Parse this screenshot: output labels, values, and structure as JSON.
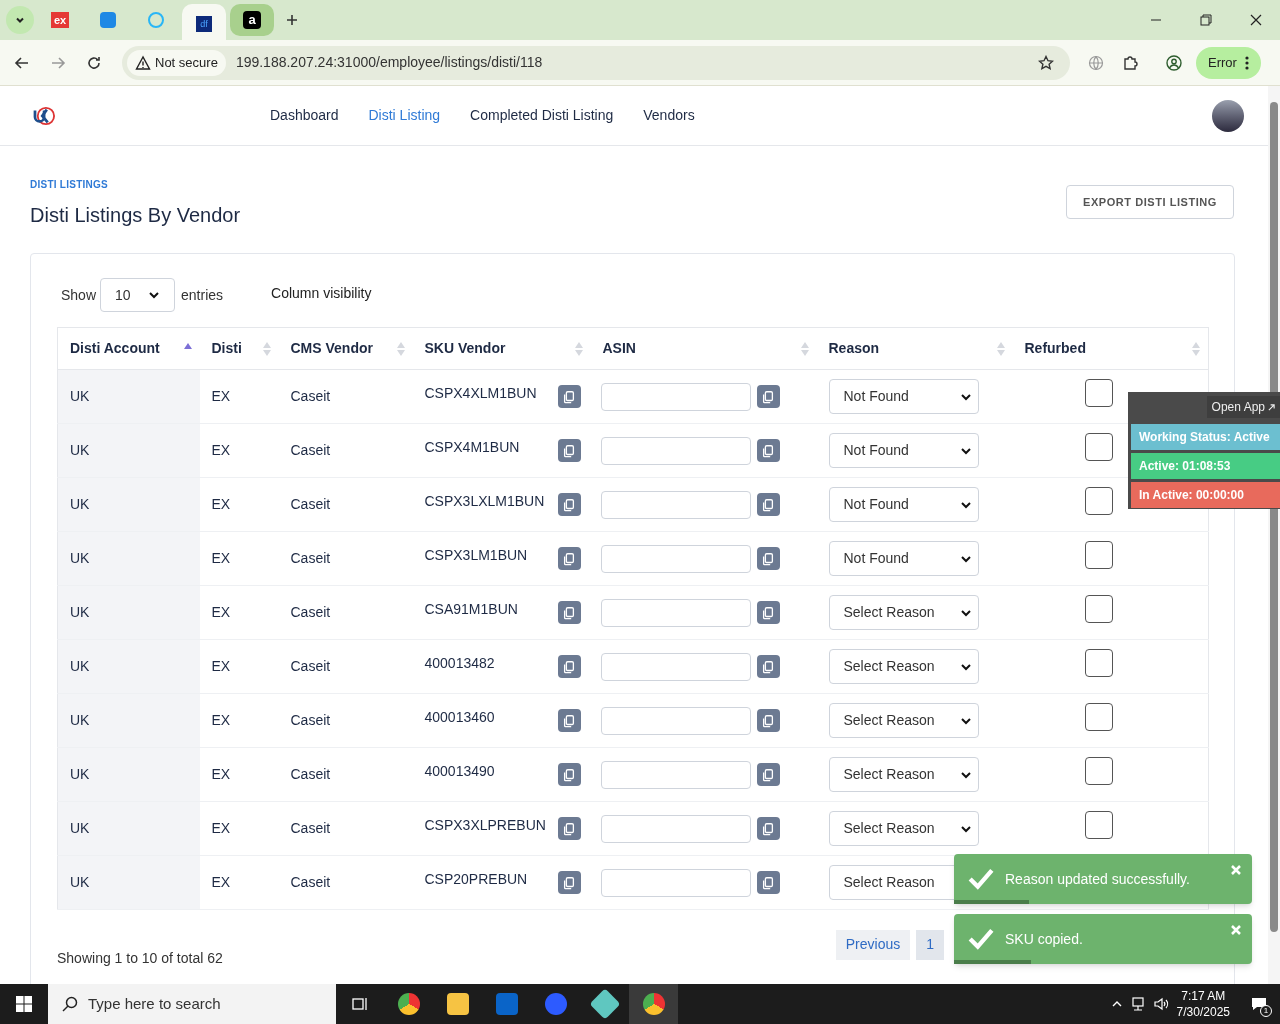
{
  "browser": {
    "tabs": [
      {
        "kind": "ex",
        "selected": false
      },
      {
        "kind": "d",
        "selected": false
      },
      {
        "kind": "c",
        "selected": false
      },
      {
        "kind": "df",
        "selected": true
      },
      {
        "kind": "a",
        "selected": false
      }
    ],
    "security": "Not secure",
    "url": "199.188.207.24:31000/employee/listings/disti/118",
    "profile_button": "Error"
  },
  "nav": {
    "items": [
      {
        "label": "Dashboard",
        "selected": false
      },
      {
        "label": "Disti Listing",
        "selected": true
      },
      {
        "label": "Completed Disti Listing",
        "selected": false
      },
      {
        "label": "Vendors",
        "selected": false
      }
    ]
  },
  "header": {
    "breadcrumb": "DISTI LISTINGS",
    "title": "Disti Listings By Vendor",
    "export_button": "EXPORT DISTI LISTING"
  },
  "controls": {
    "show_label": "Show",
    "entries_value": "10",
    "entries_label": "entries",
    "column_visibility": "Column visibility"
  },
  "table": {
    "columns": [
      {
        "label": "Disti Account",
        "sorted": true
      },
      {
        "label": "Disti",
        "sorted": false
      },
      {
        "label": "CMS Vendor",
        "sorted": false
      },
      {
        "label": "SKU Vendor",
        "sorted": false
      },
      {
        "label": "ASIN",
        "sorted": false
      },
      {
        "label": "Reason",
        "sorted": false
      },
      {
        "label": "Refurbed",
        "sorted": false
      }
    ],
    "rows": [
      {
        "account": "UK",
        "disti": "EX",
        "vendor": "Caseit",
        "sku": "CSPX4XLM1BUN",
        "reason": "Not Found",
        "refurbed": false
      },
      {
        "account": "UK",
        "disti": "EX",
        "vendor": "Caseit",
        "sku": "CSPX4M1BUN",
        "reason": "Not Found",
        "refurbed": false
      },
      {
        "account": "UK",
        "disti": "EX",
        "vendor": "Caseit",
        "sku": "CSPX3LXLM1BUN",
        "reason": "Not Found",
        "refurbed": false
      },
      {
        "account": "UK",
        "disti": "EX",
        "vendor": "Caseit",
        "sku": "CSPX3LM1BUN",
        "reason": "Not Found",
        "refurbed": false
      },
      {
        "account": "UK",
        "disti": "EX",
        "vendor": "Caseit",
        "sku": "CSA91M1BUN",
        "reason": "Select Reason",
        "refurbed": false
      },
      {
        "account": "UK",
        "disti": "EX",
        "vendor": "Caseit",
        "sku": "400013482",
        "reason": "Select Reason",
        "refurbed": false
      },
      {
        "account": "UK",
        "disti": "EX",
        "vendor": "Caseit",
        "sku": "400013460",
        "reason": "Select Reason",
        "refurbed": false
      },
      {
        "account": "UK",
        "disti": "EX",
        "vendor": "Caseit",
        "sku": "400013490",
        "reason": "Select Reason",
        "refurbed": false
      },
      {
        "account": "UK",
        "disti": "EX",
        "vendor": "Caseit",
        "sku": "CSPX3XLPREBUN",
        "reason": "Select Reason",
        "refurbed": false
      },
      {
        "account": "UK",
        "disti": "EX",
        "vendor": "Caseit",
        "sku": "CSP20PREBUN",
        "reason": "Select Reason"
      }
    ]
  },
  "footer": {
    "info": "Showing 1 to 10 of total 62",
    "previous": "Previous",
    "pages": [
      {
        "label": "1",
        "selected": true
      }
    ]
  },
  "status_widget": {
    "open_app": "Open App",
    "working_status": "Working Status: Active",
    "active": "Active: 01:08:53",
    "inactive": "In Active: 00:00:00"
  },
  "toasts": [
    {
      "message": "Reason updated successfully.",
      "level": 0.25
    },
    {
      "message": "SKU copied.",
      "level": 0.26
    }
  ],
  "taskbar": {
    "search_placeholder": "Type here to search",
    "time": "7:17 AM",
    "date": "7/30/2025",
    "notifications": "1"
  }
}
